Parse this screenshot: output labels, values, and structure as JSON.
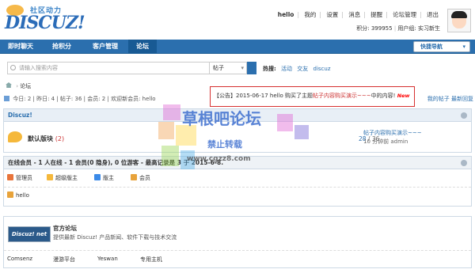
{
  "header": {
    "logo_sub": "社区动力",
    "logo_main": "DISCUZ!",
    "user": {
      "name": "hello",
      "links": [
        "我的",
        "设置",
        "消息",
        "提醒",
        "论坛管理",
        "退出"
      ],
      "points": "积分: 399955",
      "group": "用户组: 实习新生"
    }
  },
  "nav": {
    "items": [
      "即时聊天",
      "抢积分",
      "客户管理",
      "论坛"
    ],
    "quick": "快捷导航"
  },
  "search": {
    "placeholder": "请输入搜索内容",
    "type": "帖子",
    "hot_label": "热搜:",
    "hot_items": [
      "活动",
      "交友",
      "discuz"
    ]
  },
  "breadcrumb": "论坛",
  "stats": {
    "text": "今日: 2 | 昨日: 4 | 帖子: 36 | 会员: 2 | 欢迎新会员: hello"
  },
  "right_links": "我的帖子  最新回复",
  "notice": {
    "prefix": "【公告】2015-06-17 hello 购买了主题",
    "topic": "帖子内容购买演示~~~",
    "suffix": "中的内容!",
    "new": "New"
  },
  "forum_section": {
    "title": "Discuz!",
    "forum_name": "默认版块",
    "today_count": "(2)",
    "threads": "28",
    "posts": "36",
    "last_post_title": "帖子内容购买演示~~~",
    "last_post_meta": "10 分钟前 admin"
  },
  "online": {
    "title": "在线会员 - 1 人在线 - 1 会员(0 隐身), 0 位游客 - 最高记录是 3 于 2015-6-8.",
    "legend": [
      "管理员",
      "超级版主",
      "版主",
      "会员"
    ],
    "users": [
      "hello"
    ],
    "legend_colors": [
      "#e8743b",
      "#f5b83b",
      "#3b8ae8",
      "#e8a33b"
    ]
  },
  "links_section": {
    "official_logo": "Discuz! net",
    "official_title": "官方论坛",
    "official_desc": "提供最新 Discuz! 产品新闻、软件下载与技术交流",
    "partners": [
      "Comsenz",
      "漫游平台",
      "Yeswan",
      "专用主机"
    ]
  },
  "watermark": {
    "line1": "草根吧论坛",
    "line2": "禁止转载",
    "line3": "www.cgzz8.com"
  }
}
